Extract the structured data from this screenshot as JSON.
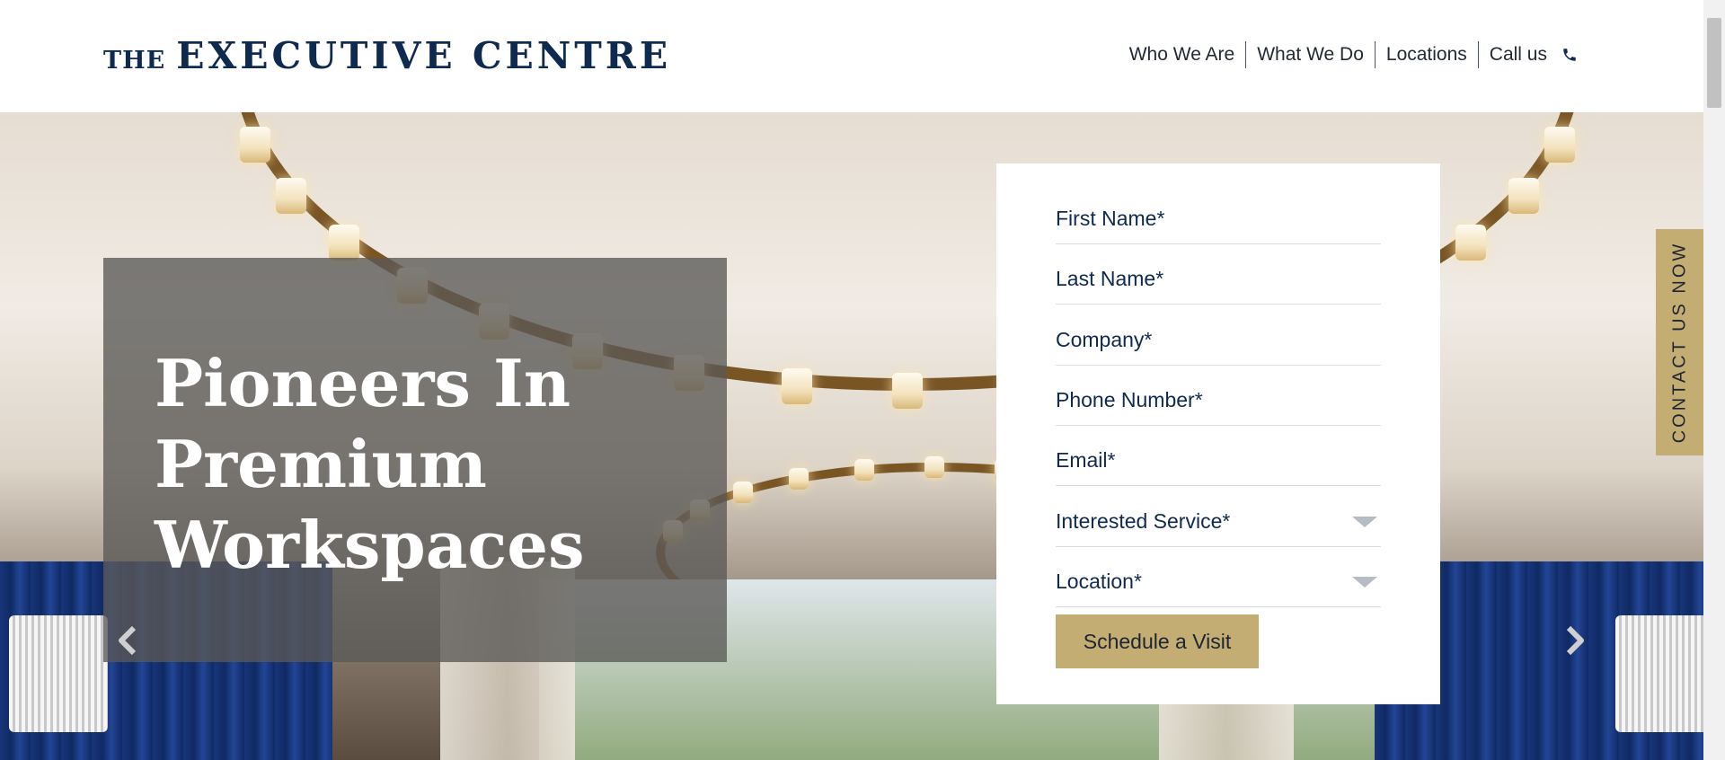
{
  "header": {
    "logo_the": "THE",
    "logo_main": "EXECUTIVE CENTRE",
    "nav": [
      {
        "label": "Who We Are"
      },
      {
        "label": "What We Do"
      },
      {
        "label": "Locations"
      },
      {
        "label": "Call us",
        "icon": "phone-icon"
      }
    ]
  },
  "hero": {
    "title_lines": [
      "Pioneers In",
      "Premium",
      "Workspaces"
    ],
    "prev_icon": "chevron-left-icon",
    "next_icon": "chevron-right-icon"
  },
  "form": {
    "fields": [
      {
        "label": "First Name*",
        "type": "text"
      },
      {
        "label": "Last Name*",
        "type": "text"
      },
      {
        "label": "Company*",
        "type": "text"
      },
      {
        "label": "Phone Number*",
        "type": "text"
      },
      {
        "label": "Email*",
        "type": "text"
      },
      {
        "label": "Interested Service*",
        "type": "select"
      },
      {
        "label": "Location*",
        "type": "select"
      }
    ],
    "submit_label": "Schedule a Visit"
  },
  "contact_tab": {
    "label": "CONTACT US NOW"
  },
  "colors": {
    "brand_navy": "#0f2a4f",
    "accent_gold": "#c4ad72"
  }
}
